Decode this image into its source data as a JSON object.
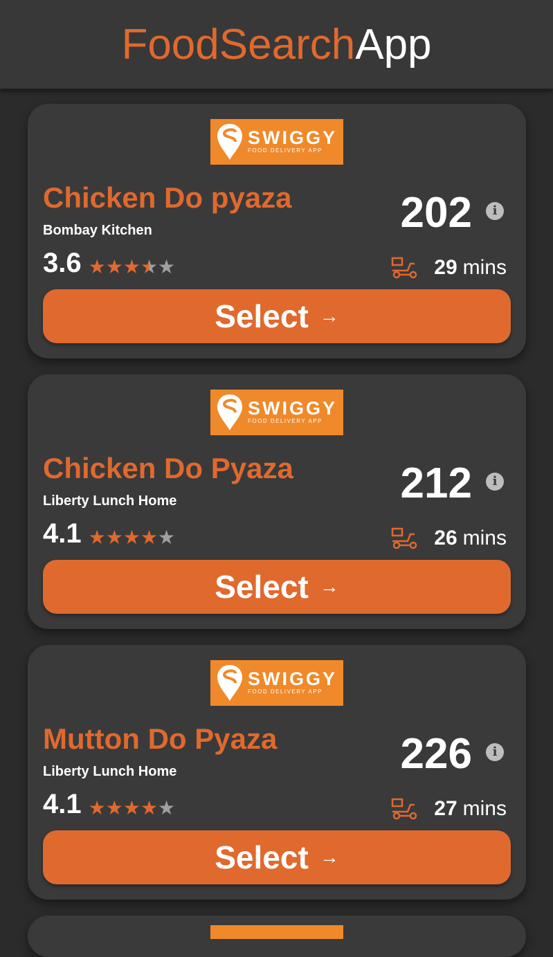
{
  "header": {
    "title_part1": "FoodSearch",
    "title_part2": "App"
  },
  "brand": {
    "name": "SWIGGY",
    "tagline": "FOOD DELIVERY APP"
  },
  "colors": {
    "accent": "#e0692e",
    "brand": "#f0892a",
    "background": "#2b2b2b",
    "card": "#3a3a3a"
  },
  "cards": [
    {
      "dish": "Chicken Do pyaza",
      "restaurant": "Bombay Kitchen",
      "rating": "3.6",
      "stars_filled": 3.5,
      "price": "202",
      "delivery_time": "29",
      "delivery_unit": "mins",
      "button_label": "Select",
      "button_arrow": "→"
    },
    {
      "dish": "Chicken Do Pyaza",
      "restaurant": "Liberty Lunch Home",
      "rating": "4.1",
      "stars_filled": 4,
      "price": "212",
      "delivery_time": "26",
      "delivery_unit": "mins",
      "button_label": "Select",
      "button_arrow": "→"
    },
    {
      "dish": "Mutton Do Pyaza",
      "restaurant": "Liberty Lunch Home",
      "rating": "4.1",
      "stars_filled": 4,
      "price": "226",
      "delivery_time": "27",
      "delivery_unit": "mins",
      "button_label": "Select",
      "button_arrow": "→"
    }
  ],
  "icons": {
    "info": "info-icon",
    "delivery": "delivery-scooter-icon",
    "star": "star-icon",
    "logo": "swiggy-logo"
  }
}
